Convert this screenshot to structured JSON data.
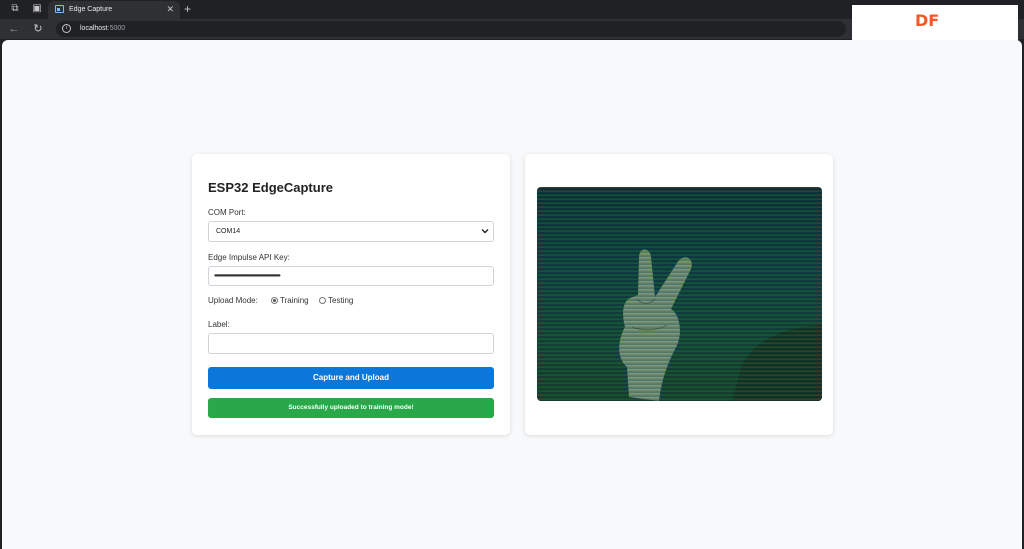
{
  "browser": {
    "tab_title": "Edge Capture",
    "url_host": "localhost",
    "url_port": ":5000"
  },
  "overlay": {
    "logo_text": "DF",
    "logo_color": "#f15a24"
  },
  "form": {
    "title": "ESP32 EdgeCapture",
    "com_port_label": "COM Port:",
    "com_port_value": "COM14",
    "api_key_label": "Edge Impulse API Key:",
    "api_key_masked": "••••••••••••••••••••••••••••••••••••••••••••••••••••••••••••••••••••••••",
    "upload_mode_label": "Upload Mode:",
    "upload_modes": [
      {
        "label": "Training",
        "selected": true
      },
      {
        "label": "Testing",
        "selected": false
      }
    ],
    "label_label": "Label:",
    "label_value": "",
    "submit_label": "Capture and Upload",
    "status_message": "Successfully uploaded to training mode!"
  },
  "preview": {
    "icon": "camera-preview-image"
  },
  "colors": {
    "primary_button": "#0c77db",
    "success": "#29a84a",
    "page_bg": "#f8f9fa"
  }
}
